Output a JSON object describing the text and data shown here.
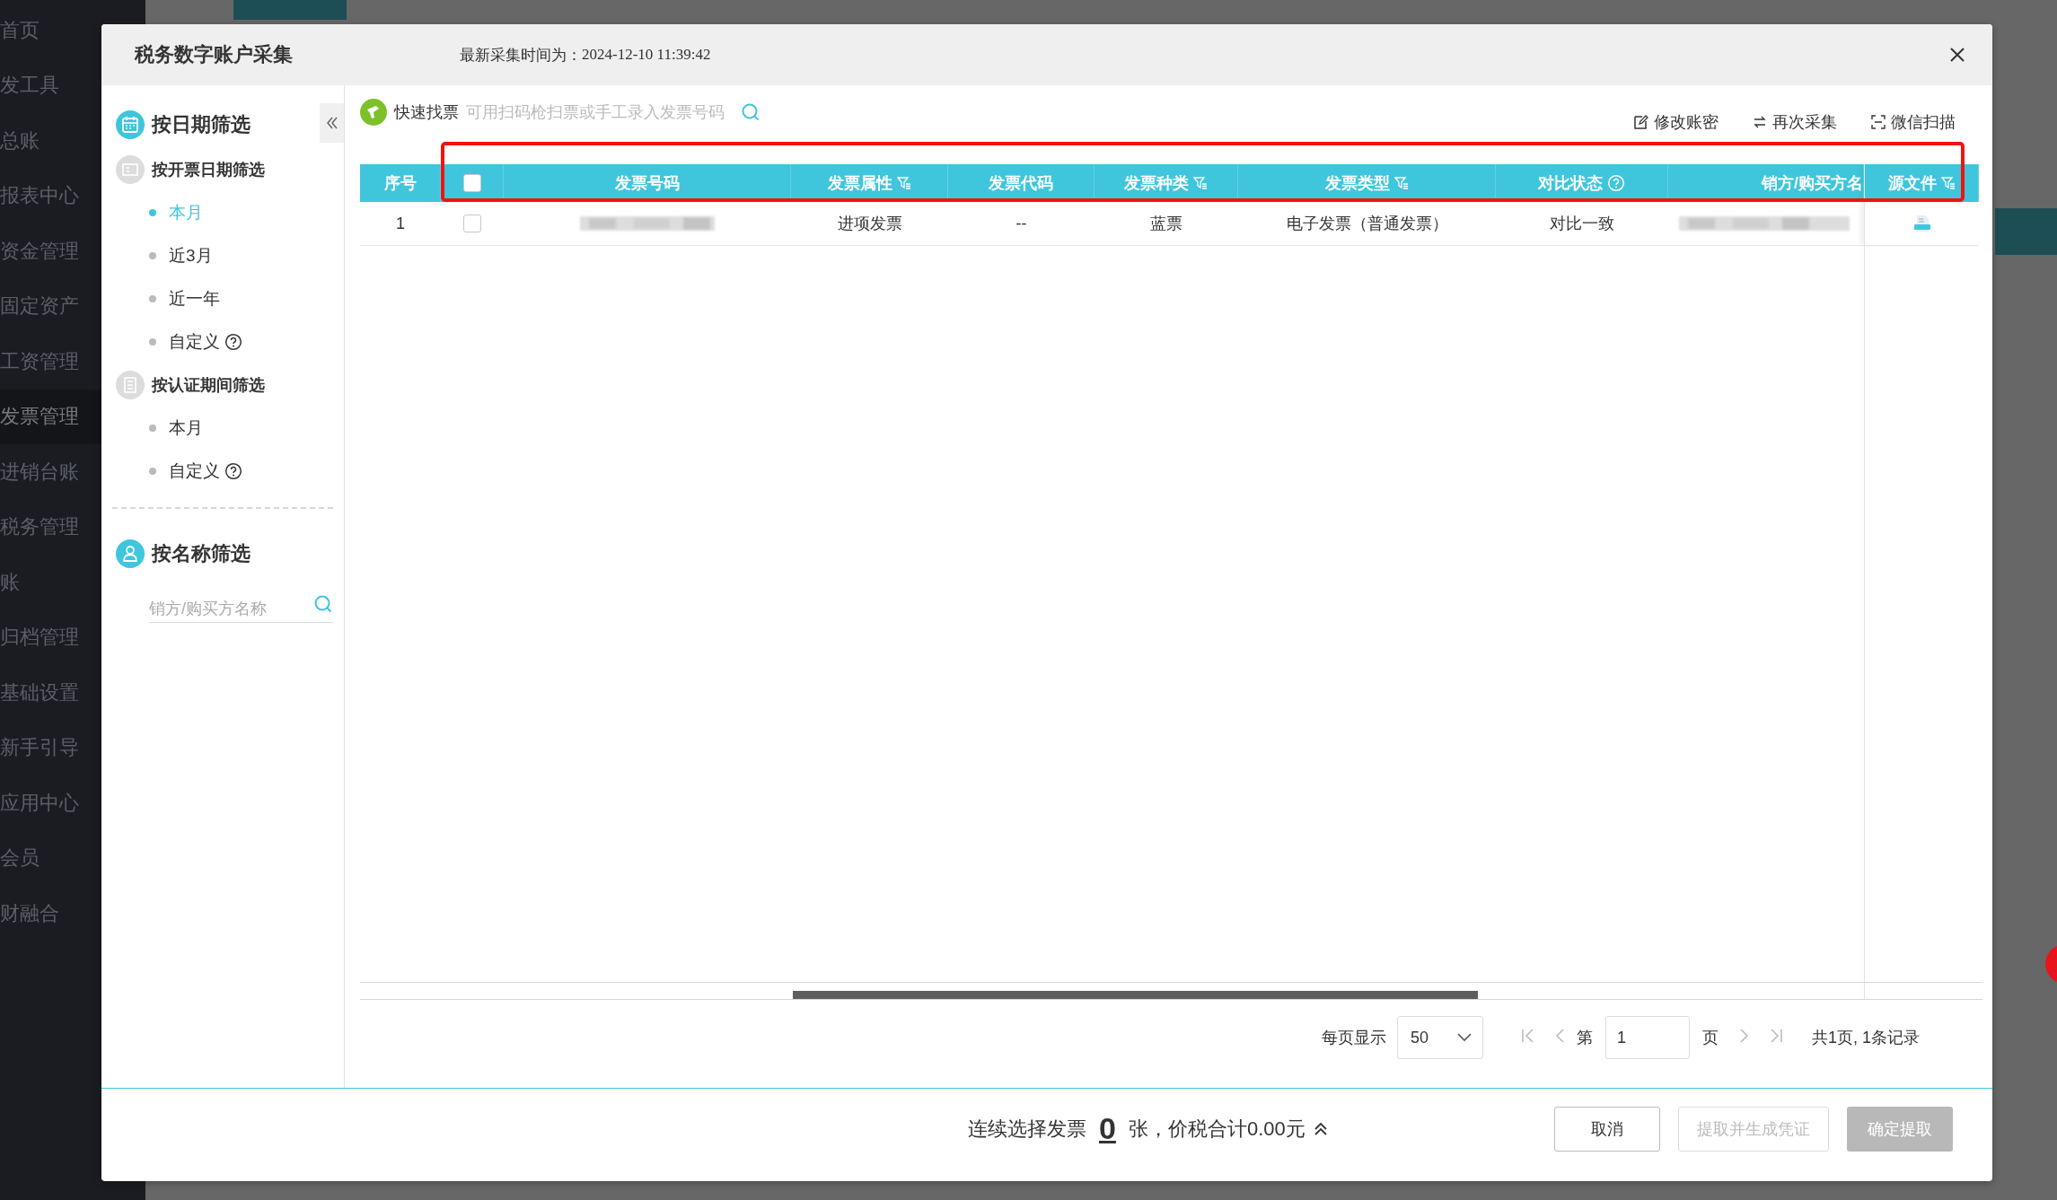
{
  "backdrop_menu": [
    {
      "label": "首页",
      "selected": false
    },
    {
      "label": "发工具",
      "selected": false
    },
    {
      "label": "总账",
      "selected": false
    },
    {
      "label": "报表中心",
      "selected": false
    },
    {
      "label": "资金管理",
      "selected": false
    },
    {
      "label": "固定资产",
      "selected": false
    },
    {
      "label": "工资管理",
      "selected": false
    },
    {
      "label": "发票管理",
      "selected": true
    },
    {
      "label": "进销台账",
      "selected": false
    },
    {
      "label": "税务管理",
      "selected": false
    },
    {
      "label": "账",
      "selected": false
    },
    {
      "label": "归档管理",
      "selected": false
    },
    {
      "label": "基础设置",
      "selected": false
    },
    {
      "label": "新手引导",
      "selected": false
    },
    {
      "label": "应用中心",
      "selected": false
    },
    {
      "label": "会员",
      "selected": false
    },
    {
      "label": "财融合",
      "selected": false
    }
  ],
  "dialog": {
    "title": "税务数字账户采集",
    "timestamp_label": "最新采集时间为：",
    "timestamp": "2024-12-10 11:39:42"
  },
  "filters": {
    "date_title": "按日期筛选",
    "groups": [
      {
        "title": "按开票日期筛选",
        "kind": "ticket",
        "items": [
          {
            "label": "本月",
            "selected": true,
            "help": false
          },
          {
            "label": "近3月",
            "selected": false,
            "help": false
          },
          {
            "label": "近一年",
            "selected": false,
            "help": false
          },
          {
            "label": "自定义",
            "selected": false,
            "help": true
          }
        ]
      },
      {
        "title": "按认证期间筛选",
        "kind": "doc",
        "items": [
          {
            "label": "本月",
            "selected": false,
            "help": false
          },
          {
            "label": "自定义",
            "selected": false,
            "help": true
          }
        ]
      }
    ],
    "name_title": "按名称筛选",
    "name_placeholder": "销方/购买方名称"
  },
  "quick_find": {
    "label": "快速找票",
    "placeholder": "可用扫码枪扫票或手工录入发票号码"
  },
  "actions": [
    {
      "kind": "edit",
      "label": "修改账密"
    },
    {
      "kind": "sync",
      "label": "再次采集"
    },
    {
      "kind": "scan",
      "label": "微信扫描"
    }
  ],
  "table": {
    "columns": [
      {
        "label": "序号",
        "kind": "text",
        "filter": false,
        "help": false
      },
      {
        "kind": "checkbox",
        "checked": false
      },
      {
        "label": "发票号码",
        "kind": "text",
        "filter": false,
        "help": false
      },
      {
        "label": "发票属性",
        "kind": "text",
        "filter": true,
        "help": false
      },
      {
        "label": "发票代码",
        "kind": "text",
        "filter": false,
        "help": false
      },
      {
        "label": "发票种类",
        "kind": "text",
        "filter": true,
        "help": false
      },
      {
        "label": "发票类型",
        "kind": "text",
        "filter": true,
        "help": false
      },
      {
        "label": "对比状态",
        "kind": "text",
        "filter": false,
        "help": true
      },
      {
        "label": "销方/购买方名",
        "kind": "text",
        "filter": false,
        "help": false
      },
      {
        "label": "源文件",
        "kind": "text",
        "filter": true,
        "help": false
      }
    ],
    "rows": [
      {
        "cells": [
          {
            "kind": "text",
            "text": "1"
          },
          {
            "kind": "checkbox",
            "checked": false
          },
          {
            "kind": "redacted"
          },
          {
            "kind": "text",
            "text": "进项发票"
          },
          {
            "kind": "text",
            "text": "--"
          },
          {
            "kind": "text",
            "text": "蓝票"
          },
          {
            "kind": "text",
            "text": "电子发票（普通发票）"
          },
          {
            "kind": "text",
            "text": "对比一致"
          },
          {
            "kind": "redacted"
          },
          {
            "kind": "file"
          }
        ]
      }
    ]
  },
  "pager": {
    "per_page_label": "每页显示",
    "per_page": "50",
    "page_prefix": "第",
    "page": "1",
    "page_suffix": "页",
    "summary": "共1页, 1条记录"
  },
  "footer": {
    "prefix": "连续选择发票",
    "count": "0",
    "suffix": "张，价税合计0.00元",
    "buttons": [
      {
        "kind": "outline",
        "label": "取消",
        "disabled": false
      },
      {
        "kind": "outline",
        "label": "提取并生成凭证",
        "disabled": true
      },
      {
        "kind": "solid",
        "label": "确定提取",
        "disabled": true
      }
    ]
  }
}
